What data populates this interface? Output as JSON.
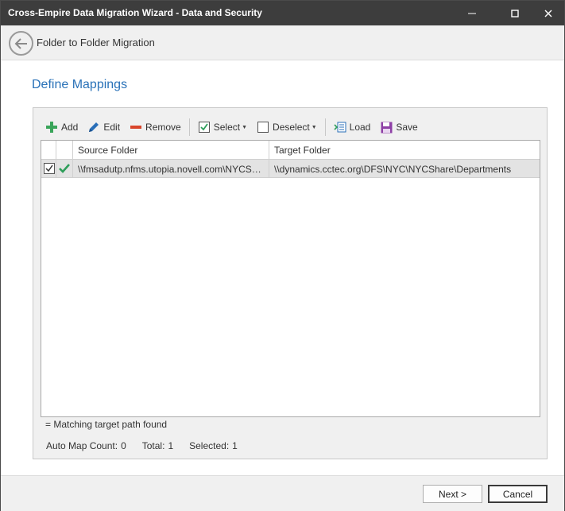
{
  "window": {
    "title": "Cross-Empire Data Migration Wizard  -  Data and Security",
    "controls": {
      "minimize": "minimize-icon",
      "maximize": "maximize-icon",
      "close": "close-icon"
    }
  },
  "nav": {
    "back_icon": "arrow-left-icon",
    "title": "Folder to Folder Migration"
  },
  "section": {
    "title": "Define Mappings"
  },
  "toolbar": {
    "add": "Add",
    "edit": "Edit",
    "remove": "Remove",
    "select": "Select",
    "deselect": "Deselect",
    "load": "Load",
    "save": "Save"
  },
  "grid": {
    "columns": [
      "",
      "",
      "Source Folder",
      "Target Folder"
    ],
    "rows": [
      {
        "checked": true,
        "status": "match",
        "source": "\\\\fmsadutp.nfms.utopia.novell.com\\NYCShare\\Departments",
        "target": "\\\\dynamics.cctec.org\\DFS\\NYC\\NYCShare\\Departments"
      }
    ]
  },
  "legend": {
    "text": " =  Matching target path found"
  },
  "stats": {
    "auto_map_label": "Auto Map Count:",
    "auto_map_value": "0",
    "total_label": "Total:",
    "total_value": "1",
    "selected_label": "Selected:",
    "selected_value": "1"
  },
  "footer": {
    "next": "Next >",
    "cancel": "Cancel"
  },
  "colors": {
    "accent": "#2a72b8",
    "add_green": "#3aa55a",
    "remove_red": "#d9452b",
    "check_green": "#2e9e5a",
    "titlebar": "#3d3d3d"
  }
}
